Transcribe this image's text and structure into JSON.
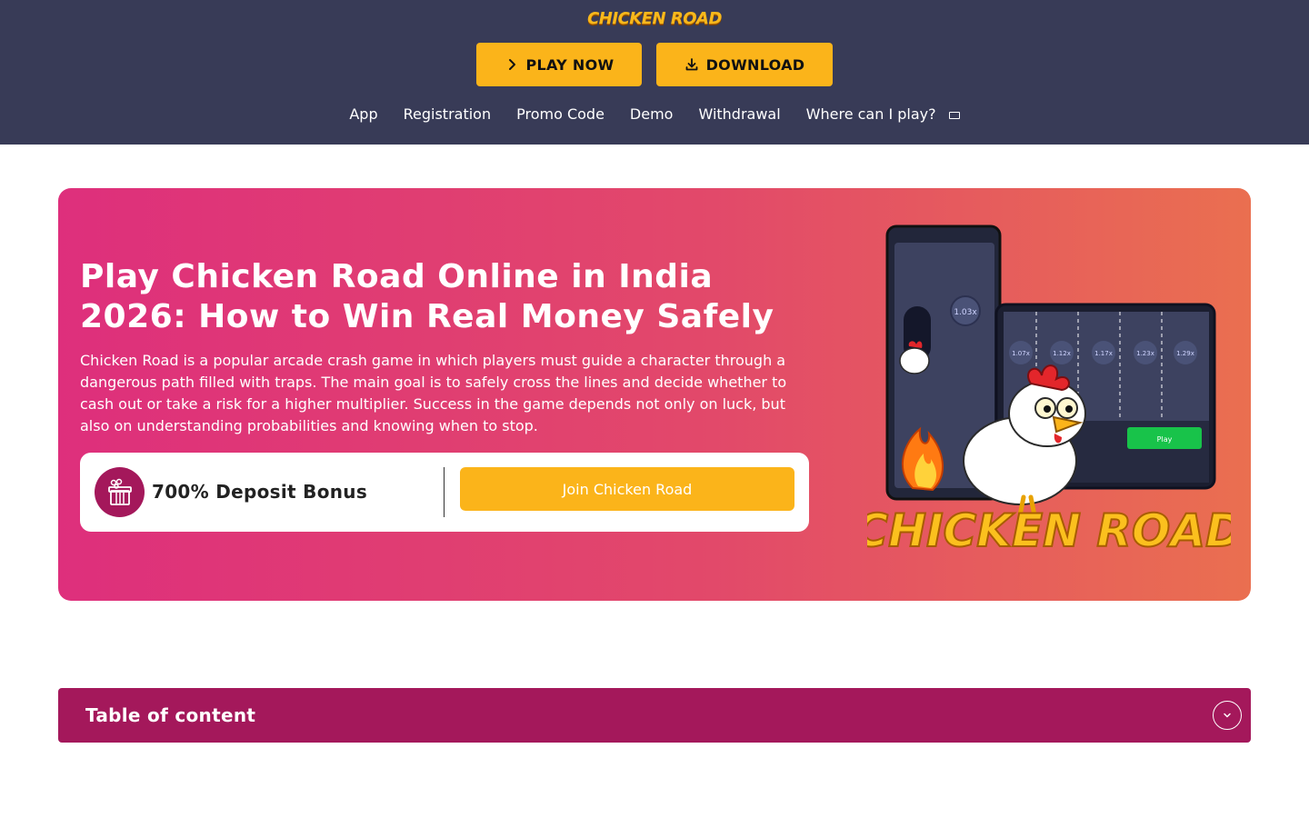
{
  "header": {
    "logo_text": "CHICKEN ROAD",
    "play_button": "PLAY NOW",
    "download_button": "DOWNLOAD",
    "nav": [
      {
        "label": "App"
      },
      {
        "label": "Registration"
      },
      {
        "label": "Promo Code"
      },
      {
        "label": "Demo"
      },
      {
        "label": "Withdrawal"
      },
      {
        "label": "Where can I play?"
      }
    ]
  },
  "hero": {
    "title": "Play Chicken Road Online in India 2026: How to Win Real Money Safely",
    "description": "Chicken Road is a popular arcade crash game in which players must guide a character through a dangerous path filled with traps. The main goal is to safely cross the lines and decide whether to cash out or take a risk for a higher multiplier. Success in the game depends not only on luck, but also on understanding probabilities and knowing when to stop.",
    "bonus_text": "700% Deposit Bonus",
    "join_button": "Join Chicken Road",
    "art": {
      "logo_text": "CHICKEN ROAD",
      "multipliers": [
        "1.03x",
        "1.07x",
        "1.12x",
        "1.17x",
        "1.23x",
        "1.29x"
      ],
      "play_label": "Play"
    }
  },
  "toc": {
    "title": "Table of content"
  },
  "colors": {
    "header_bg": "#383b57",
    "accent_yellow": "#fbb41a",
    "toc_bg": "#a4185b",
    "hero_gradient_start": "#de2f7c",
    "hero_gradient_end": "#ea6f50"
  },
  "icons": {
    "play": "chevron-right-icon",
    "download": "download-icon",
    "nav_dropdown": "dropdown-caret-icon",
    "bonus": "gift-icon",
    "toc_toggle": "chevron-down-icon"
  }
}
